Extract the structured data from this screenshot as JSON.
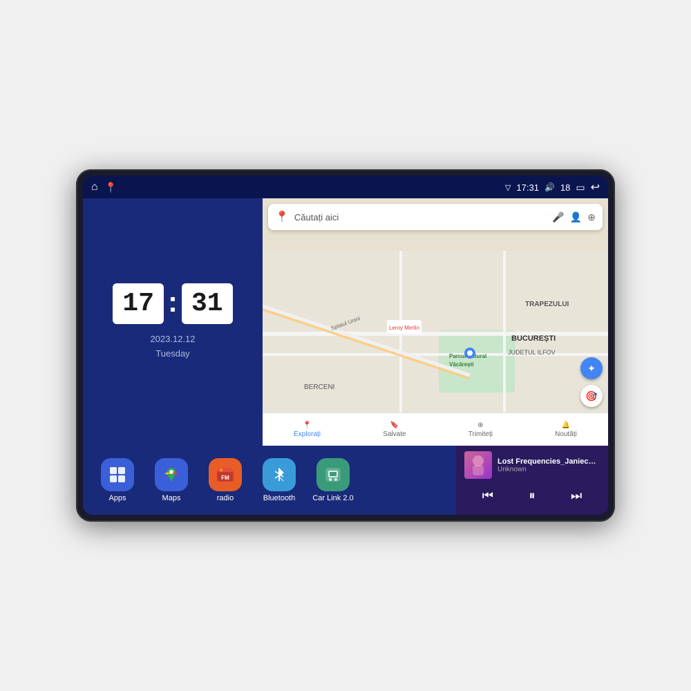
{
  "device": {
    "screen": {
      "statusBar": {
        "time": "17:31",
        "signal": "▽",
        "volume": "18",
        "battery": "▭",
        "back": "↩"
      },
      "clockPanel": {
        "hours": "17",
        "minutes": "31",
        "date": "2023.12.12",
        "day": "Tuesday"
      },
      "mapPanel": {
        "searchPlaceholder": "Căutați aici",
        "navItems": [
          {
            "label": "Explorați",
            "icon": "📍"
          },
          {
            "label": "Salvate",
            "icon": "🔖"
          },
          {
            "label": "Trimiteți",
            "icon": "⊕"
          },
          {
            "label": "Noutăți",
            "icon": "🔔"
          }
        ],
        "locationLabel": "BUCUREȘTI",
        "subLabel": "JUDEȚUL ILFOV",
        "parkLabel": "Parcul Natural Văcărești",
        "area1": "BERCENI",
        "area2": "TRAPEZULUI",
        "street": "Splaiul Unirii",
        "store": "Leroy Merlin"
      },
      "appsRow": [
        {
          "id": "apps",
          "label": "Apps",
          "iconClass": "apps-icon",
          "emoji": "⊞"
        },
        {
          "id": "maps",
          "label": "Maps",
          "iconClass": "maps-icon",
          "emoji": "📍"
        },
        {
          "id": "radio",
          "label": "radio",
          "iconClass": "radio-icon",
          "emoji": "📻"
        },
        {
          "id": "bluetooth",
          "label": "Bluetooth",
          "iconClass": "bluetooth-icon",
          "emoji": "⚡"
        },
        {
          "id": "carlink",
          "label": "Car Link 2.0",
          "iconClass": "carlink-icon",
          "emoji": "📱"
        }
      ],
      "musicPanel": {
        "title": "Lost Frequencies_Janieck Devy-...",
        "artist": "Unknown",
        "prevLabel": "⏮",
        "playLabel": "⏸",
        "nextLabel": "⏭"
      }
    }
  }
}
